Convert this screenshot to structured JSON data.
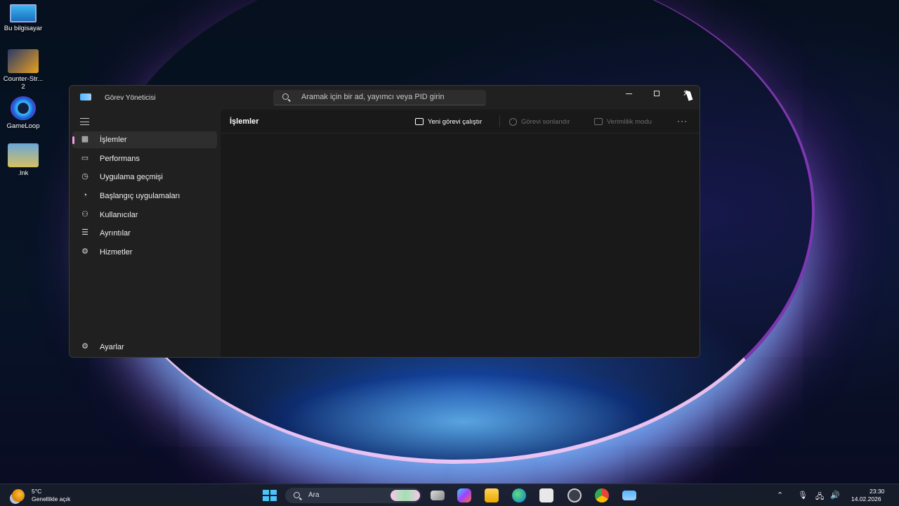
{
  "desktop": {
    "icons": [
      {
        "label": "Bu bilgisayar"
      },
      {
        "label": "Counter-Str... 2"
      },
      {
        "label": "GameLoop"
      },
      {
        "label": ".lnk"
      }
    ]
  },
  "window": {
    "title": "Görev Yöneticisi",
    "search_placeholder": "Aramak için bir ad, yayımcı veya PID girin",
    "sidebar": {
      "items": [
        {
          "label": "İşlemler",
          "icon": "processes-icon",
          "active": true
        },
        {
          "label": "Performans",
          "icon": "performance-icon"
        },
        {
          "label": "Uygulama geçmişi",
          "icon": "history-icon"
        },
        {
          "label": "Başlangıç uygulamaları",
          "icon": "startup-icon"
        },
        {
          "label": "Kullanıcılar",
          "icon": "users-icon"
        },
        {
          "label": "Ayrıntılar",
          "icon": "details-icon"
        },
        {
          "label": "Hizmetler",
          "icon": "services-icon"
        }
      ],
      "settings_label": "Ayarlar"
    },
    "main": {
      "title": "İşlemler",
      "toolbar": {
        "run_task": "Yeni görevi çalıştır",
        "end_task": "Görevi sonlandır",
        "efficiency": "Verimlilik modu",
        "more": "···"
      }
    }
  },
  "taskbar": {
    "weather_temp": "5°C",
    "weather_desc": "Genellikle açık",
    "search_label": "Ara",
    "time": "23:30",
    "date": "14.02.2026"
  },
  "colors": {
    "accent": "#4cc2ff",
    "active_indicator": "#f1a0e0",
    "window_bg": "#202020",
    "content_bg": "#191919"
  }
}
